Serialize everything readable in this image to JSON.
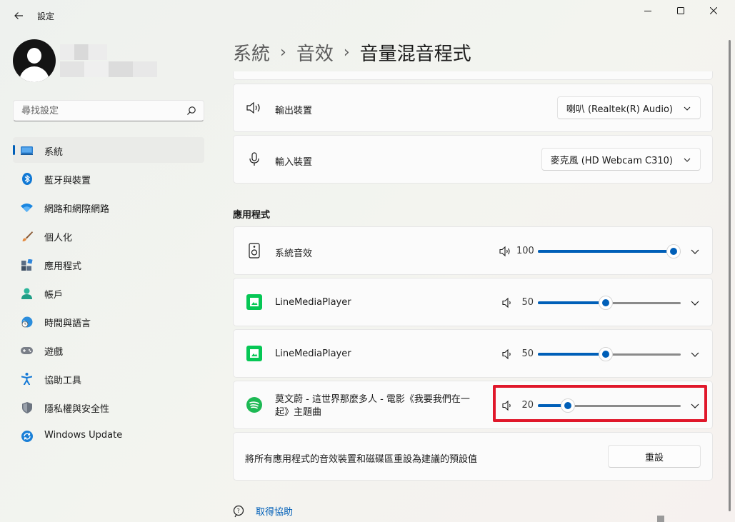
{
  "window": {
    "title": "設定"
  },
  "search": {
    "placeholder": "尋找設定"
  },
  "sidebar": {
    "items": [
      {
        "label": "系統",
        "icon": "system-display-icon",
        "selected": true
      },
      {
        "label": "藍牙與裝置",
        "icon": "bluetooth-icon"
      },
      {
        "label": "網路和網際網路",
        "icon": "wifi-icon"
      },
      {
        "label": "個人化",
        "icon": "paintbrush-icon"
      },
      {
        "label": "應用程式",
        "icon": "apps-icon"
      },
      {
        "label": "帳戶",
        "icon": "account-icon"
      },
      {
        "label": "時間與語言",
        "icon": "clock-globe-icon"
      },
      {
        "label": "遊戲",
        "icon": "gamepad-icon"
      },
      {
        "label": "協助工具",
        "icon": "accessibility-icon"
      },
      {
        "label": "隱私權與安全性",
        "icon": "shield-icon"
      },
      {
        "label": "Windows Update",
        "icon": "windows-update-icon"
      }
    ]
  },
  "breadcrumb": {
    "items": [
      "系統",
      "音效",
      "音量混音程式"
    ],
    "separator": "›"
  },
  "devices": {
    "output": {
      "label": "輸出裝置",
      "value": "喇叭 (Realtek(R) Audio)"
    },
    "input": {
      "label": "輸入裝置",
      "value": "麥克風 (HD Webcam C310)"
    }
  },
  "apps": {
    "heading": "應用程式",
    "items": [
      {
        "name": "系統音效",
        "volume": "100",
        "level": 1.0
      },
      {
        "name": "LineMediaPlayer",
        "volume": "50",
        "level": 0.5
      },
      {
        "name": "LineMediaPlayer",
        "volume": "50",
        "level": 0.5
      },
      {
        "name": "莫文蔚 - 這世界那麼多人 - 電影《我要我們在一起》主題曲",
        "volume": "20",
        "level": 0.22
      }
    ]
  },
  "reset": {
    "description": "將所有應用程式的音效裝置和磁碟區重設為建議的預設值",
    "button_label": "重設"
  },
  "help": {
    "label": "取得協助"
  },
  "colors": {
    "accent": "#005fb8",
    "highlight": "#e0182b",
    "line_green": "#06c755",
    "spotify_green": "#1db954"
  }
}
